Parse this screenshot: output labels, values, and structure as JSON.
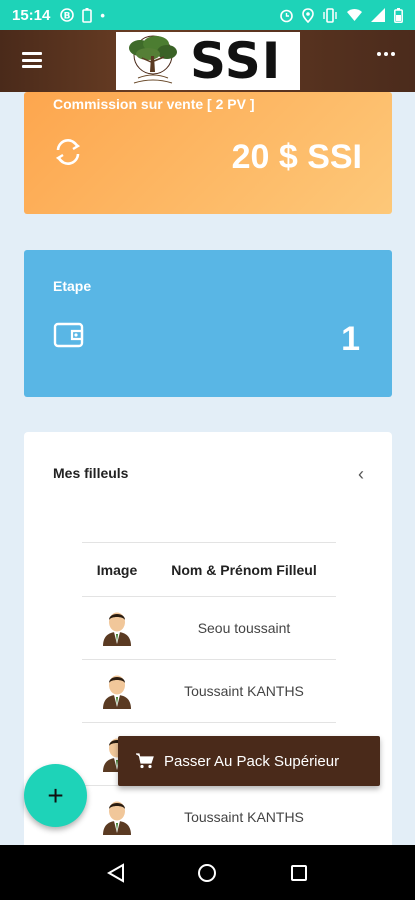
{
  "status_bar": {
    "time": "15:14",
    "left_icons": [
      "notification-icon",
      "battery-saver-icon",
      "dot-icon"
    ],
    "right_icons": [
      "alarm-icon",
      "location-icon",
      "vibrate-icon",
      "wifi-icon",
      "signal-icon",
      "battery-icon"
    ]
  },
  "app_bar": {
    "logo_text": "SSI",
    "menu_icon": "hamburger-icon",
    "more_icon": "more-dots-icon",
    "color": "#5a3420"
  },
  "commission_card": {
    "title": "Commission sur vente [ 2 PV ]",
    "value": "20 $ SSI",
    "icon": "refresh-icon",
    "color": "#fdb060"
  },
  "etape_card": {
    "title": "Etape",
    "value": "1",
    "icon": "wallet-icon",
    "color": "#59b6e5"
  },
  "filleuls": {
    "title": "Mes filleuls",
    "collapse_icon": "chevron-left-icon",
    "columns": [
      "Image",
      "Nom & Prénom Filleul"
    ],
    "rows": [
      {
        "name": "Seou toussaint"
      },
      {
        "name": "Toussaint KANTHS"
      },
      {
        "name": ""
      },
      {
        "name": "Toussaint KANTHS"
      }
    ]
  },
  "fab": {
    "label": "+",
    "color": "#1ed3b8"
  },
  "upgrade_button": {
    "label": "Passer Au Pack Supérieur",
    "icon": "cart-icon"
  },
  "nav_bar": {
    "icons": [
      "back-icon",
      "home-icon",
      "recents-icon"
    ]
  }
}
